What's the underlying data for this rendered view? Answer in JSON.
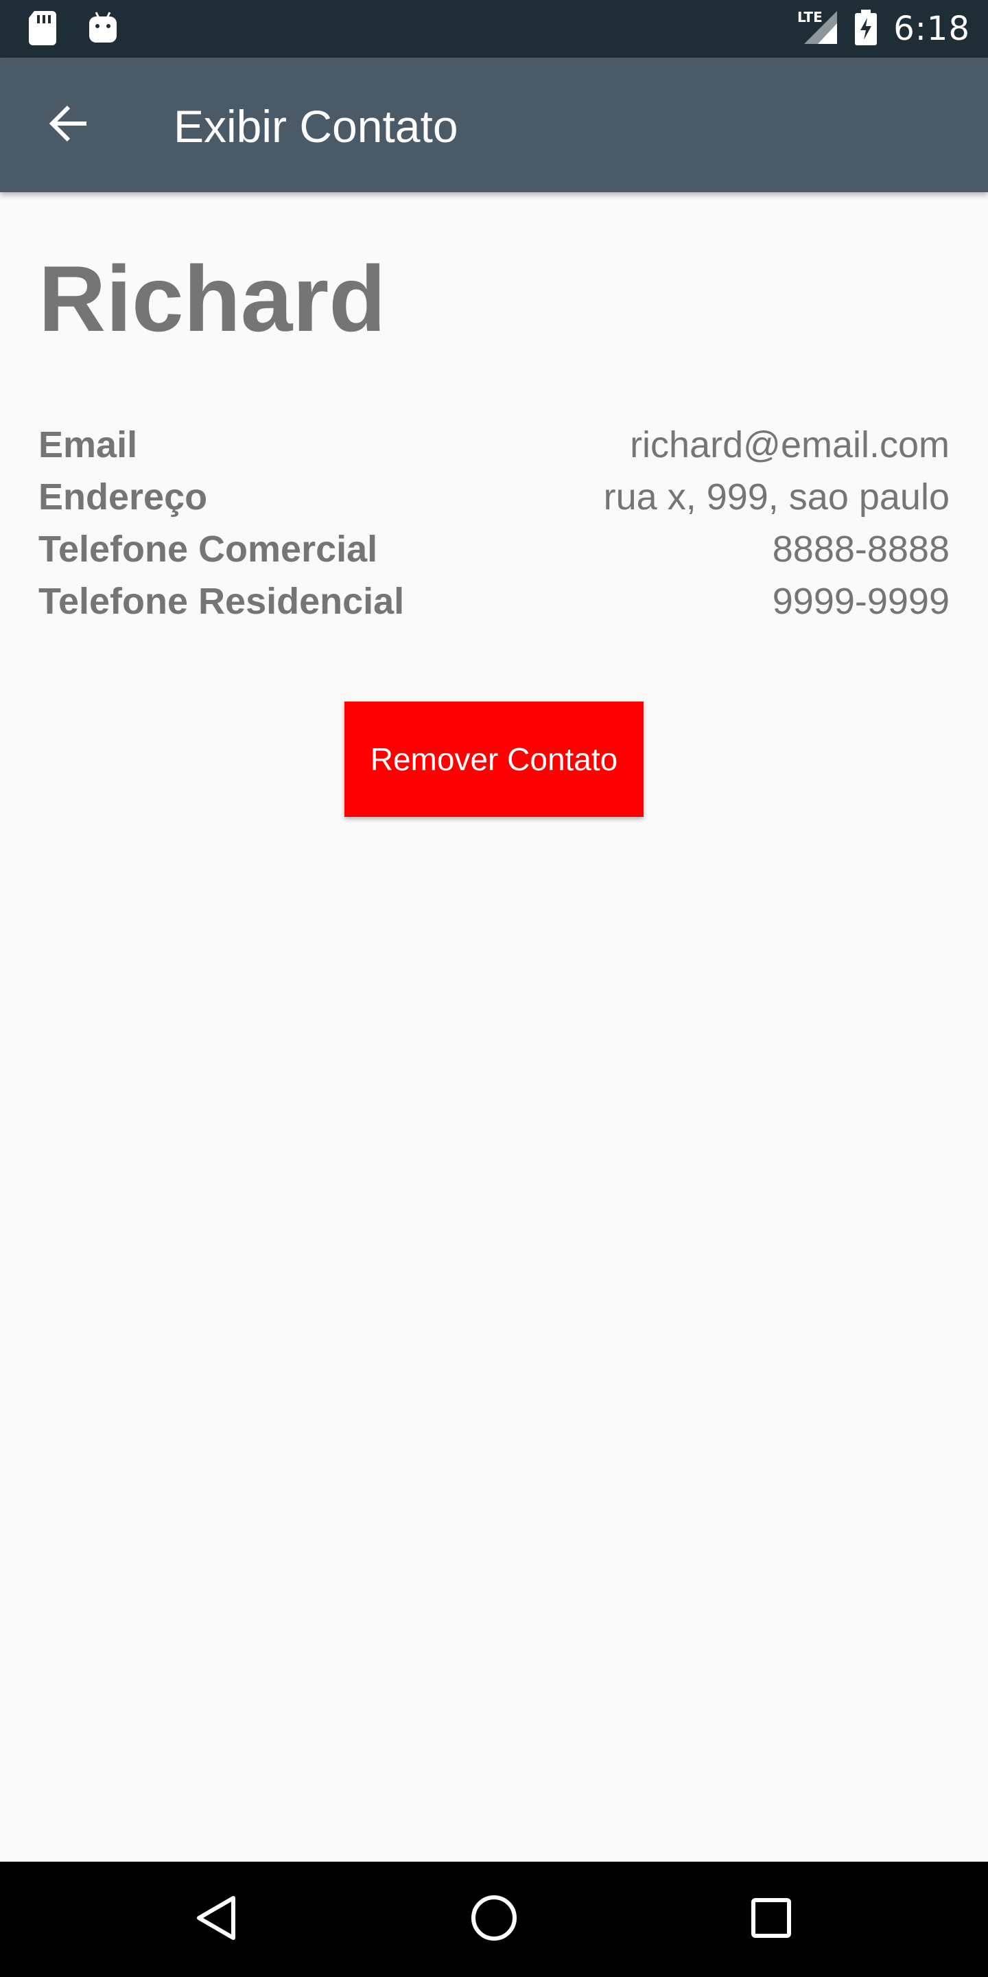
{
  "status_bar": {
    "time": "6:18",
    "network": "LTE",
    "icons": [
      "sd-card-icon",
      "android-icon",
      "lte-signal-icon",
      "battery-charging-icon"
    ]
  },
  "app_bar": {
    "title": "Exibir Contato",
    "back_icon": "arrow-back-icon"
  },
  "contact": {
    "name": "Richard",
    "fields": [
      {
        "label": "Email",
        "value": "richard@email.com"
      },
      {
        "label": "Endereço",
        "value": "rua x, 999, sao paulo"
      },
      {
        "label": "Telefone Comercial",
        "value": "8888-8888"
      },
      {
        "label": "Telefone Residencial",
        "value": "9999-9999"
      }
    ]
  },
  "actions": {
    "remove_label": "Remover Contato"
  },
  "colors": {
    "status_bar": "#1f2d37",
    "app_bar": "#4a5a66",
    "background": "#fafafa",
    "text": "#757575",
    "remove_button": "#ff0000"
  },
  "nav_bar": {
    "icons": [
      "back-triangle-icon",
      "home-circle-icon",
      "recents-square-icon"
    ]
  }
}
